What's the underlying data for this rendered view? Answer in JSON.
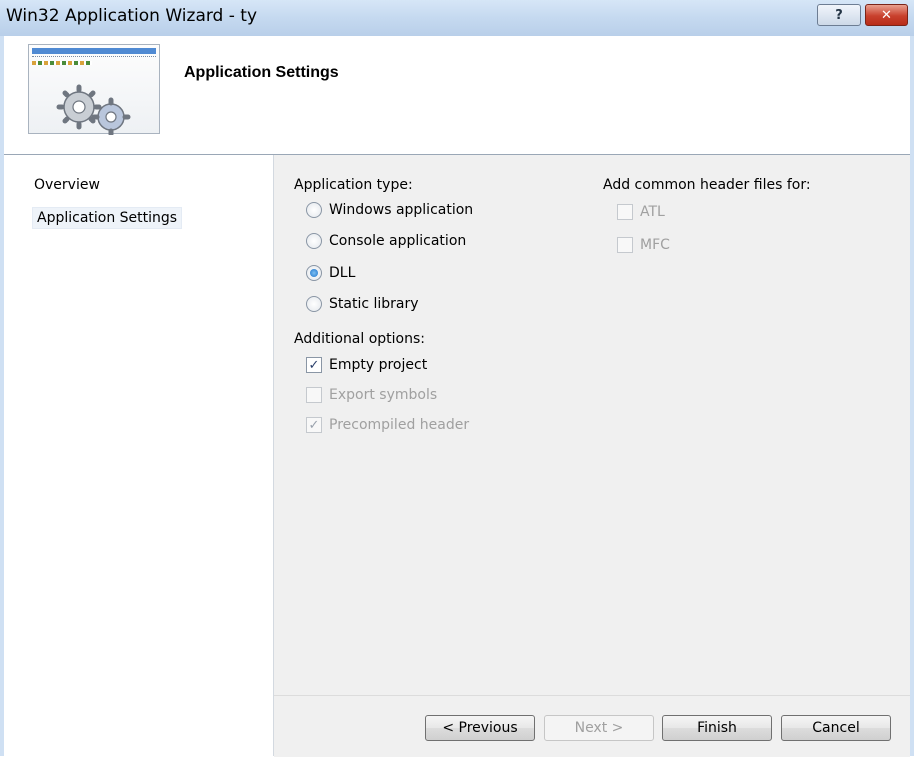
{
  "window": {
    "title": "Win32 Application Wizard - ty",
    "help_label": "?",
    "close_label": "✕"
  },
  "header": {
    "title": "Application Settings",
    "banner_icon": "gears-icon"
  },
  "sidebar": {
    "items": [
      {
        "label": "Overview"
      },
      {
        "label": "Application Settings"
      }
    ]
  },
  "app_type": {
    "label": "Application type:",
    "options": [
      {
        "label": "Windows application",
        "selected": false
      },
      {
        "label": "Console application",
        "selected": false
      },
      {
        "label": "DLL",
        "selected": true
      },
      {
        "label": "Static library",
        "selected": false
      }
    ]
  },
  "additional": {
    "label": "Additional options:",
    "options": [
      {
        "label": "Empty project",
        "checked": true,
        "enabled": true
      },
      {
        "label": "Export symbols",
        "checked": false,
        "enabled": false
      },
      {
        "label": "Precompiled header",
        "checked": true,
        "enabled": false
      }
    ]
  },
  "common_headers": {
    "label": "Add common header files for:",
    "options": [
      {
        "label": "ATL",
        "checked": false,
        "enabled": false
      },
      {
        "label": "MFC",
        "checked": false,
        "enabled": false
      }
    ]
  },
  "footer": {
    "previous": "< Previous",
    "next": "Next >",
    "finish": "Finish",
    "cancel": "Cancel"
  }
}
